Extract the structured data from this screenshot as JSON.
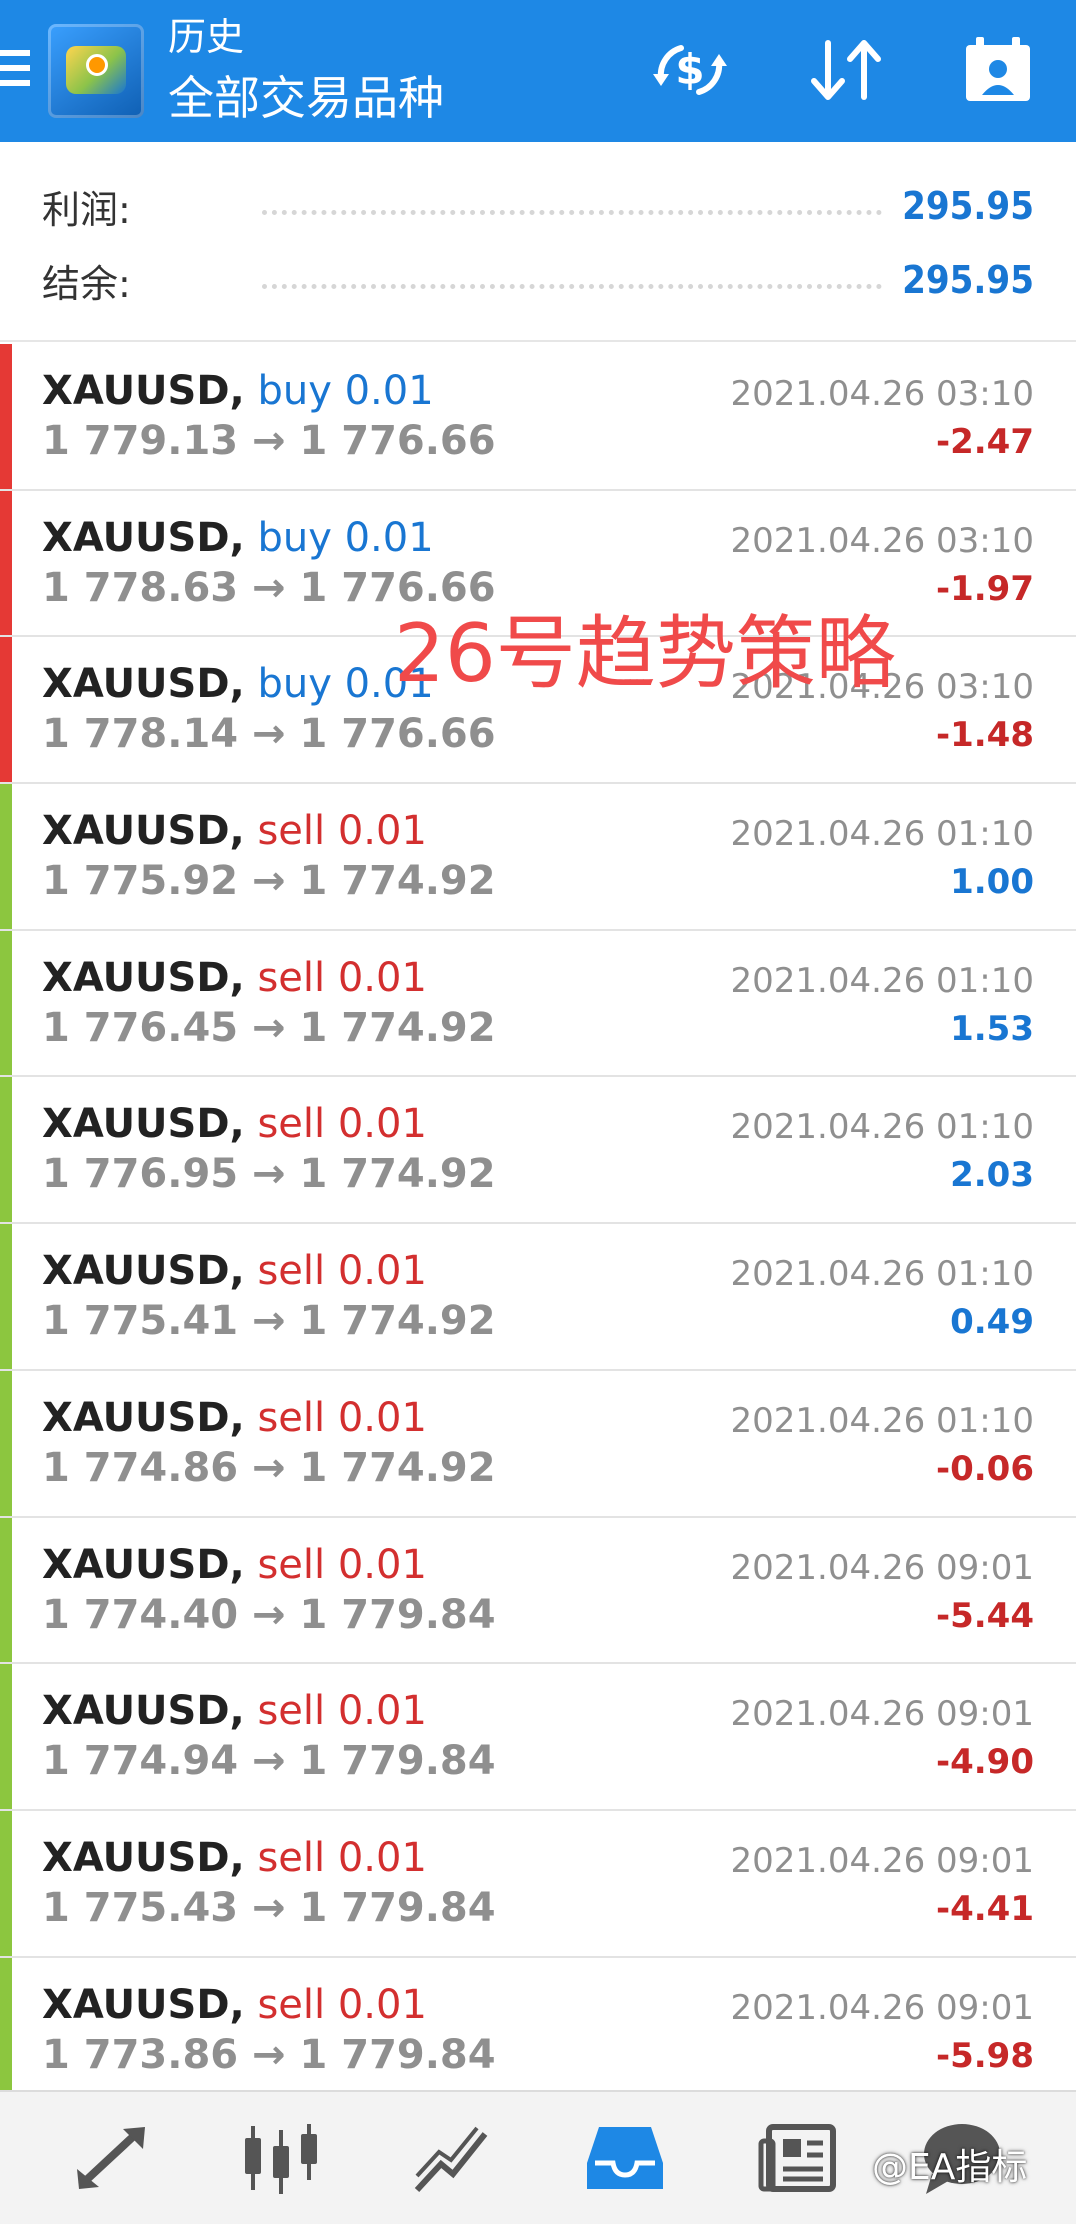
{
  "header": {
    "title": "历史",
    "subtitle": "全部交易品种",
    "background": "#1e88e5",
    "icons": [
      "menu-icon",
      "app-logo",
      "currency-exchange-icon",
      "sort-icon",
      "calendar-person-icon"
    ]
  },
  "summary": {
    "profit_label": "利润:",
    "profit_value": "295.95",
    "balance_label": "结余:",
    "balance_value": "295.95"
  },
  "trades": [
    {
      "symbol": "XAUUSD,",
      "side": "buy 0.01",
      "side_type": "buy",
      "prices": "1 779.13 → 1 776.66",
      "time": "2021.04.26 03:10",
      "pnl": "-2.47",
      "pnl_sign": "neg"
    },
    {
      "symbol": "XAUUSD,",
      "side": "buy 0.01",
      "side_type": "buy",
      "prices": "1 778.63 → 1 776.66",
      "time": "2021.04.26 03:10",
      "pnl": "-1.97",
      "pnl_sign": "neg"
    },
    {
      "symbol": "XAUUSD,",
      "side": "buy 0.01",
      "side_type": "buy",
      "prices": "1 778.14 → 1 776.66",
      "time": "2021.04.26 03:10",
      "pnl": "-1.48",
      "pnl_sign": "neg"
    },
    {
      "symbol": "XAUUSD,",
      "side": "sell 0.01",
      "side_type": "sell",
      "prices": "1 775.92 → 1 774.92",
      "time": "2021.04.26 01:10",
      "pnl": "1.00",
      "pnl_sign": "pos"
    },
    {
      "symbol": "XAUUSD,",
      "side": "sell 0.01",
      "side_type": "sell",
      "prices": "1 776.45 → 1 774.92",
      "time": "2021.04.26 01:10",
      "pnl": "1.53",
      "pnl_sign": "pos"
    },
    {
      "symbol": "XAUUSD,",
      "side": "sell 0.01",
      "side_type": "sell",
      "prices": "1 776.95 → 1 774.92",
      "time": "2021.04.26 01:10",
      "pnl": "2.03",
      "pnl_sign": "pos"
    },
    {
      "symbol": "XAUUSD,",
      "side": "sell 0.01",
      "side_type": "sell",
      "prices": "1 775.41 → 1 774.92",
      "time": "2021.04.26 01:10",
      "pnl": "0.49",
      "pnl_sign": "pos"
    },
    {
      "symbol": "XAUUSD,",
      "side": "sell 0.01",
      "side_type": "sell",
      "prices": "1 774.86 → 1 774.92",
      "time": "2021.04.26 01:10",
      "pnl": "-0.06",
      "pnl_sign": "neg"
    },
    {
      "symbol": "XAUUSD,",
      "side": "sell 0.01",
      "side_type": "sell",
      "prices": "1 774.40 → 1 779.84",
      "time": "2021.04.26 09:01",
      "pnl": "-5.44",
      "pnl_sign": "neg"
    },
    {
      "symbol": "XAUUSD,",
      "side": "sell 0.01",
      "side_type": "sell",
      "prices": "1 774.94 → 1 779.84",
      "time": "2021.04.26 09:01",
      "pnl": "-4.90",
      "pnl_sign": "neg"
    },
    {
      "symbol": "XAUUSD,",
      "side": "sell 0.01",
      "side_type": "sell",
      "prices": "1 775.43 → 1 779.84",
      "time": "2021.04.26 09:01",
      "pnl": "-4.41",
      "pnl_sign": "neg"
    },
    {
      "symbol": "XAUUSD,",
      "side": "sell 0.01",
      "side_type": "sell",
      "prices": "1 773.86 → 1 779.84",
      "time": "2021.04.26 09:01",
      "pnl": "-5.98",
      "pnl_sign": "neg"
    }
  ],
  "overlay_text": "26号趋势策略",
  "watermark": "@EA指标",
  "colors": {
    "buy": "#1976d2",
    "sell": "#d32f2f",
    "pos": "#1976d2",
    "neg": "#c62828",
    "bar_buy": "#e53935",
    "bar_sell": "#8cc63f"
  },
  "nav": {
    "items": [
      "trade-icon",
      "quotes-chart-icon",
      "chart-icon",
      "history-inbox-icon",
      "news-icon",
      "chat-icon"
    ],
    "active": "history-inbox-icon"
  }
}
